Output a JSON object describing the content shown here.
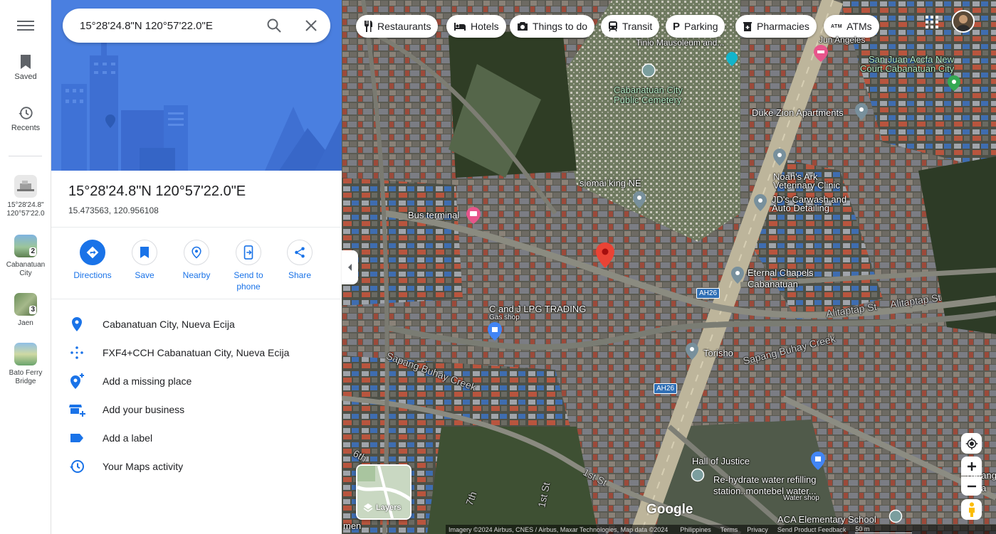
{
  "rail": {
    "saved_label": "Saved",
    "recents_label": "Recents",
    "recent_items": [
      {
        "label": "15°28'24.8\" 120°57'22.0",
        "badge": ""
      },
      {
        "label": "Cabanatuan City",
        "badge": "2"
      },
      {
        "label": "Jaen",
        "badge": "3"
      },
      {
        "label": "Bato Ferry Bridge",
        "badge": ""
      }
    ]
  },
  "search": {
    "value": "15°28'24.8\"N 120°57'22.0\"E",
    "search_icon": "search-icon",
    "close_icon": "close-icon"
  },
  "place": {
    "title": "15°28'24.8\"N 120°57'22.0\"E",
    "decimal": "15.473563, 120.956108"
  },
  "actions": [
    {
      "label": "Directions",
      "icon": "directions-icon"
    },
    {
      "label": "Save",
      "icon": "bookmark-icon"
    },
    {
      "label": "Nearby",
      "icon": "nearby-icon"
    },
    {
      "label": "Send to phone",
      "icon": "send-to-phone-icon"
    },
    {
      "label": "Share",
      "icon": "share-icon"
    }
  ],
  "info": [
    {
      "text": "Cabanatuan City, Nueva Ecija",
      "icon": "location-pin-icon"
    },
    {
      "text": "FXF4+CCH Cabanatuan City, Nueva Ecija",
      "icon": "plus-code-icon"
    },
    {
      "text": "Add a missing place",
      "icon": "add-place-icon"
    },
    {
      "text": "Add your business",
      "icon": "add-business-icon"
    },
    {
      "text": "Add a label",
      "icon": "label-icon"
    },
    {
      "text": "Your Maps activity",
      "icon": "history-icon"
    }
  ],
  "chips": [
    {
      "label": "Restaurants",
      "icon": "restaurant-icon"
    },
    {
      "label": "Hotels",
      "icon": "hotel-icon"
    },
    {
      "label": "Things to do",
      "icon": "camera-icon"
    },
    {
      "label": "Transit",
      "icon": "transit-icon"
    },
    {
      "label": "Parking",
      "icon": "parking-icon"
    },
    {
      "label": "Pharmacies",
      "icon": "pharmacy-icon"
    },
    {
      "label": "ATMs",
      "icon": "atm-icon"
    }
  ],
  "map_labels": {
    "jun_angeles": "Jun Angeles",
    "tinio": "Tinio Mausoleum and...",
    "san_juan": "San Juan Accfa New",
    "court": "Court Cabanatuan City",
    "cemetery_1": "Cabanatuan City",
    "cemetery_2": "Public Cemetery",
    "duke": "Duke Zion Apartments",
    "noahs_1": "Noah's Ark",
    "noahs_2": "Veterinary Clinic",
    "siomai": "siomai king NE",
    "jds_1": "JD's Carwash and",
    "jds_2": "Auto Detailing",
    "bus": "Bus terminal",
    "eternal_1": "Eternal Chapels",
    "eternal_2": "Cabanatuan",
    "ah26": "AH26",
    "alitaptap": "Alitaptap St",
    "cj_1": "C and J LPG TRADING",
    "cj_2": "Gas shop",
    "torisho": "Torisho",
    "creek": "Sapang Buhay Creek",
    "hall": "Hall of Justice",
    "rehydrate_1": "Re-hydrate water refilling",
    "rehydrate_2": "station..montebel water...",
    "rehydrate_3": "Water shop",
    "aca": "ACA Elementary School",
    "sixth": "6th",
    "first": "1st St",
    "seventh": "7th",
    "first_st": "1st St",
    "barangay": "Barangay",
    "ga": "Ga",
    "men": "men"
  },
  "layers_label": "Layers",
  "google_logo": "Google",
  "footer": {
    "imagery": "Imagery ©2024 Airbus, CNES / Airbus, Maxar Technologies, Map data ©2024",
    "country": "Philippines",
    "terms": "Terms",
    "privacy": "Privacy",
    "feedback": "Send Product Feedback",
    "scale": "50 m"
  },
  "colors": {
    "accent": "#1a73e8",
    "pin_red": "#ea4335",
    "hero_blue": "#4a7fe0"
  }
}
